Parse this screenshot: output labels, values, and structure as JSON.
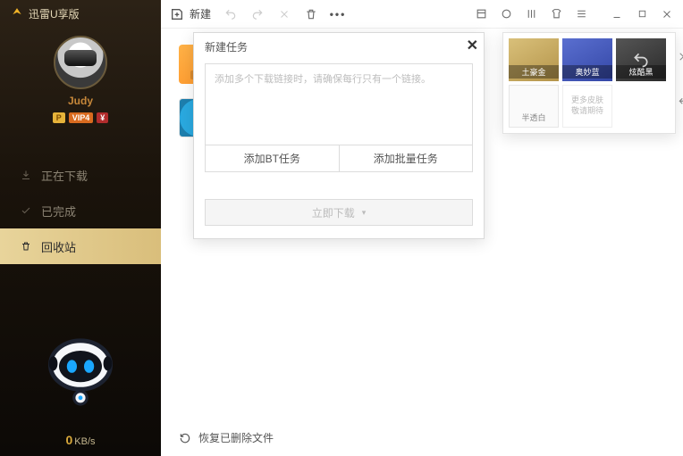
{
  "app": {
    "title": "迅雷U享版"
  },
  "profile": {
    "username": "Judy",
    "badges": [
      "P",
      "VIP4",
      "¥"
    ]
  },
  "sidebar": {
    "items": [
      {
        "icon": "download-icon",
        "label": "正在下载",
        "active": false
      },
      {
        "icon": "check-icon",
        "label": "已完成",
        "active": false
      },
      {
        "icon": "trash-icon",
        "label": "回收站",
        "active": true
      }
    ]
  },
  "speed": {
    "value": "0",
    "unit": "KB/s"
  },
  "topbar": {
    "new_label": "新建",
    "icons": [
      "undo-icon",
      "redo-icon",
      "close-small-icon",
      "trash-icon",
      "more-icon"
    ],
    "right_icons": [
      "skin1-icon",
      "skin2-icon",
      "skin3-icon",
      "skin4-icon",
      "menu-icon"
    ],
    "window": [
      "minimize-icon",
      "maximize-icon",
      "close-icon"
    ]
  },
  "recycle": {
    "items": [
      "bt-folder",
      "disc-image"
    ],
    "restore_label": "恢复已删除文件"
  },
  "dialog": {
    "title": "新建任务",
    "placeholder": "添加多个下载链接时，请确保每行只有一个链接。",
    "add_bt_label": "添加BT任务",
    "add_batch_label": "添加批量任务",
    "submit_label": "立即下载"
  },
  "theme": {
    "swatches": [
      {
        "key": "gold",
        "label": "土豪金"
      },
      {
        "key": "blue",
        "label": "奥妙蓝"
      },
      {
        "key": "dark",
        "label": "炫酷黑"
      },
      {
        "key": "white",
        "label": "半透白"
      },
      {
        "key": "more",
        "label": "更多皮肤\n敬请期待"
      }
    ]
  }
}
